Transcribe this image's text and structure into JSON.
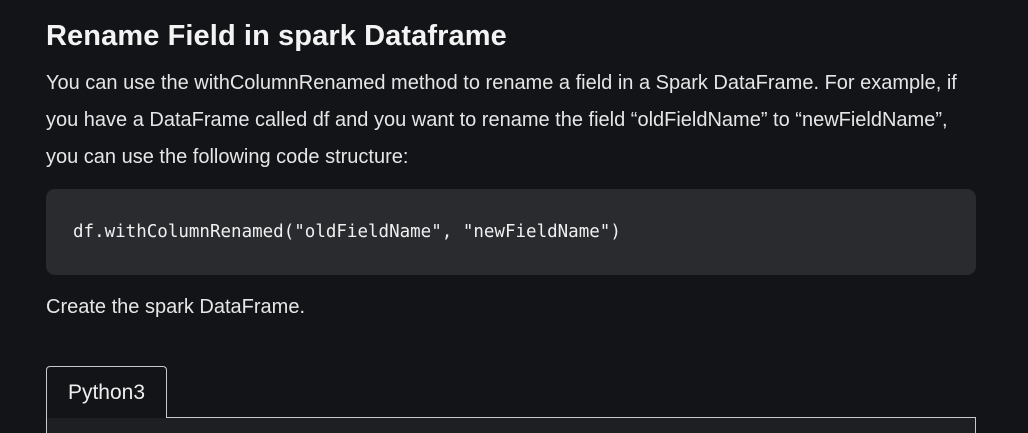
{
  "article": {
    "title": "Rename Field in spark Dataframe",
    "intro": "You can use the withColumnRenamed method to rename a field in a Spark DataFrame. For example, if you have a DataFrame called df and you want to rename the field “oldFieldName” to “newFieldName”, you can use the following code structure:",
    "code": "df.withColumnRenamed(\"oldFieldName\", \"newFieldName\")",
    "followup": "Create the spark DataFrame."
  },
  "code_tabs": {
    "tabs": [
      {
        "label": "Python3",
        "selected": true
      }
    ]
  },
  "colors": {
    "background": "#131417",
    "code_background": "#2a2b2f",
    "text": "#e6e6e7",
    "tab_border": "#c9c9cb"
  }
}
